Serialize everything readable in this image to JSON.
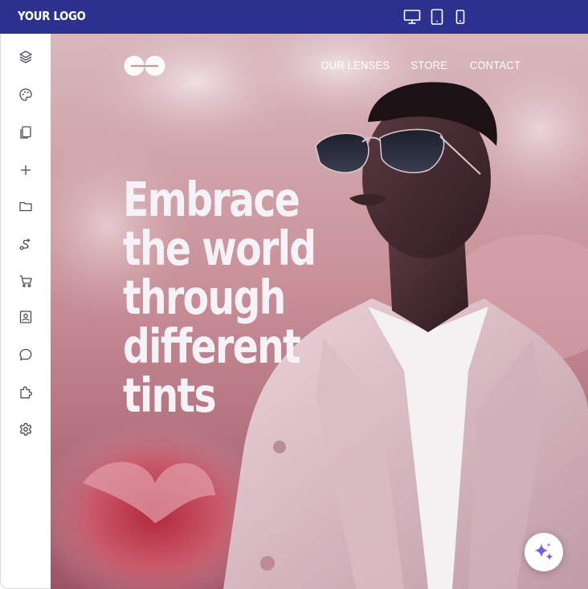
{
  "topbar": {
    "logo": "YOUR LOGO",
    "devices": [
      {
        "name": "desktop-view",
        "icon": "monitor-icon"
      },
      {
        "name": "tablet-view",
        "icon": "tablet-icon"
      },
      {
        "name": "mobile-view",
        "icon": "smartphone-icon"
      }
    ]
  },
  "sidebar": {
    "items": [
      {
        "icon": "layers-icon"
      },
      {
        "icon": "palette-icon"
      },
      {
        "icon": "pages-icon"
      },
      {
        "icon": "plus-icon"
      },
      {
        "icon": "folder-icon"
      },
      {
        "icon": "route-icon"
      },
      {
        "icon": "cart-icon"
      },
      {
        "icon": "contact-card-icon"
      },
      {
        "icon": "chat-icon"
      },
      {
        "icon": "puzzle-icon"
      },
      {
        "icon": "gear-icon"
      }
    ]
  },
  "site": {
    "nav": [
      "OUR LENSES",
      "STORE",
      "CONTACT"
    ],
    "hero_lines": [
      "Embrace",
      "the world",
      "through",
      "different",
      "tints"
    ]
  },
  "assistant": {
    "icon": "sparkles-icon"
  },
  "colors": {
    "topbar": "#2c3190",
    "sidebar_icons": "#4a4a55",
    "sparkle": "#7b5ce0"
  }
}
